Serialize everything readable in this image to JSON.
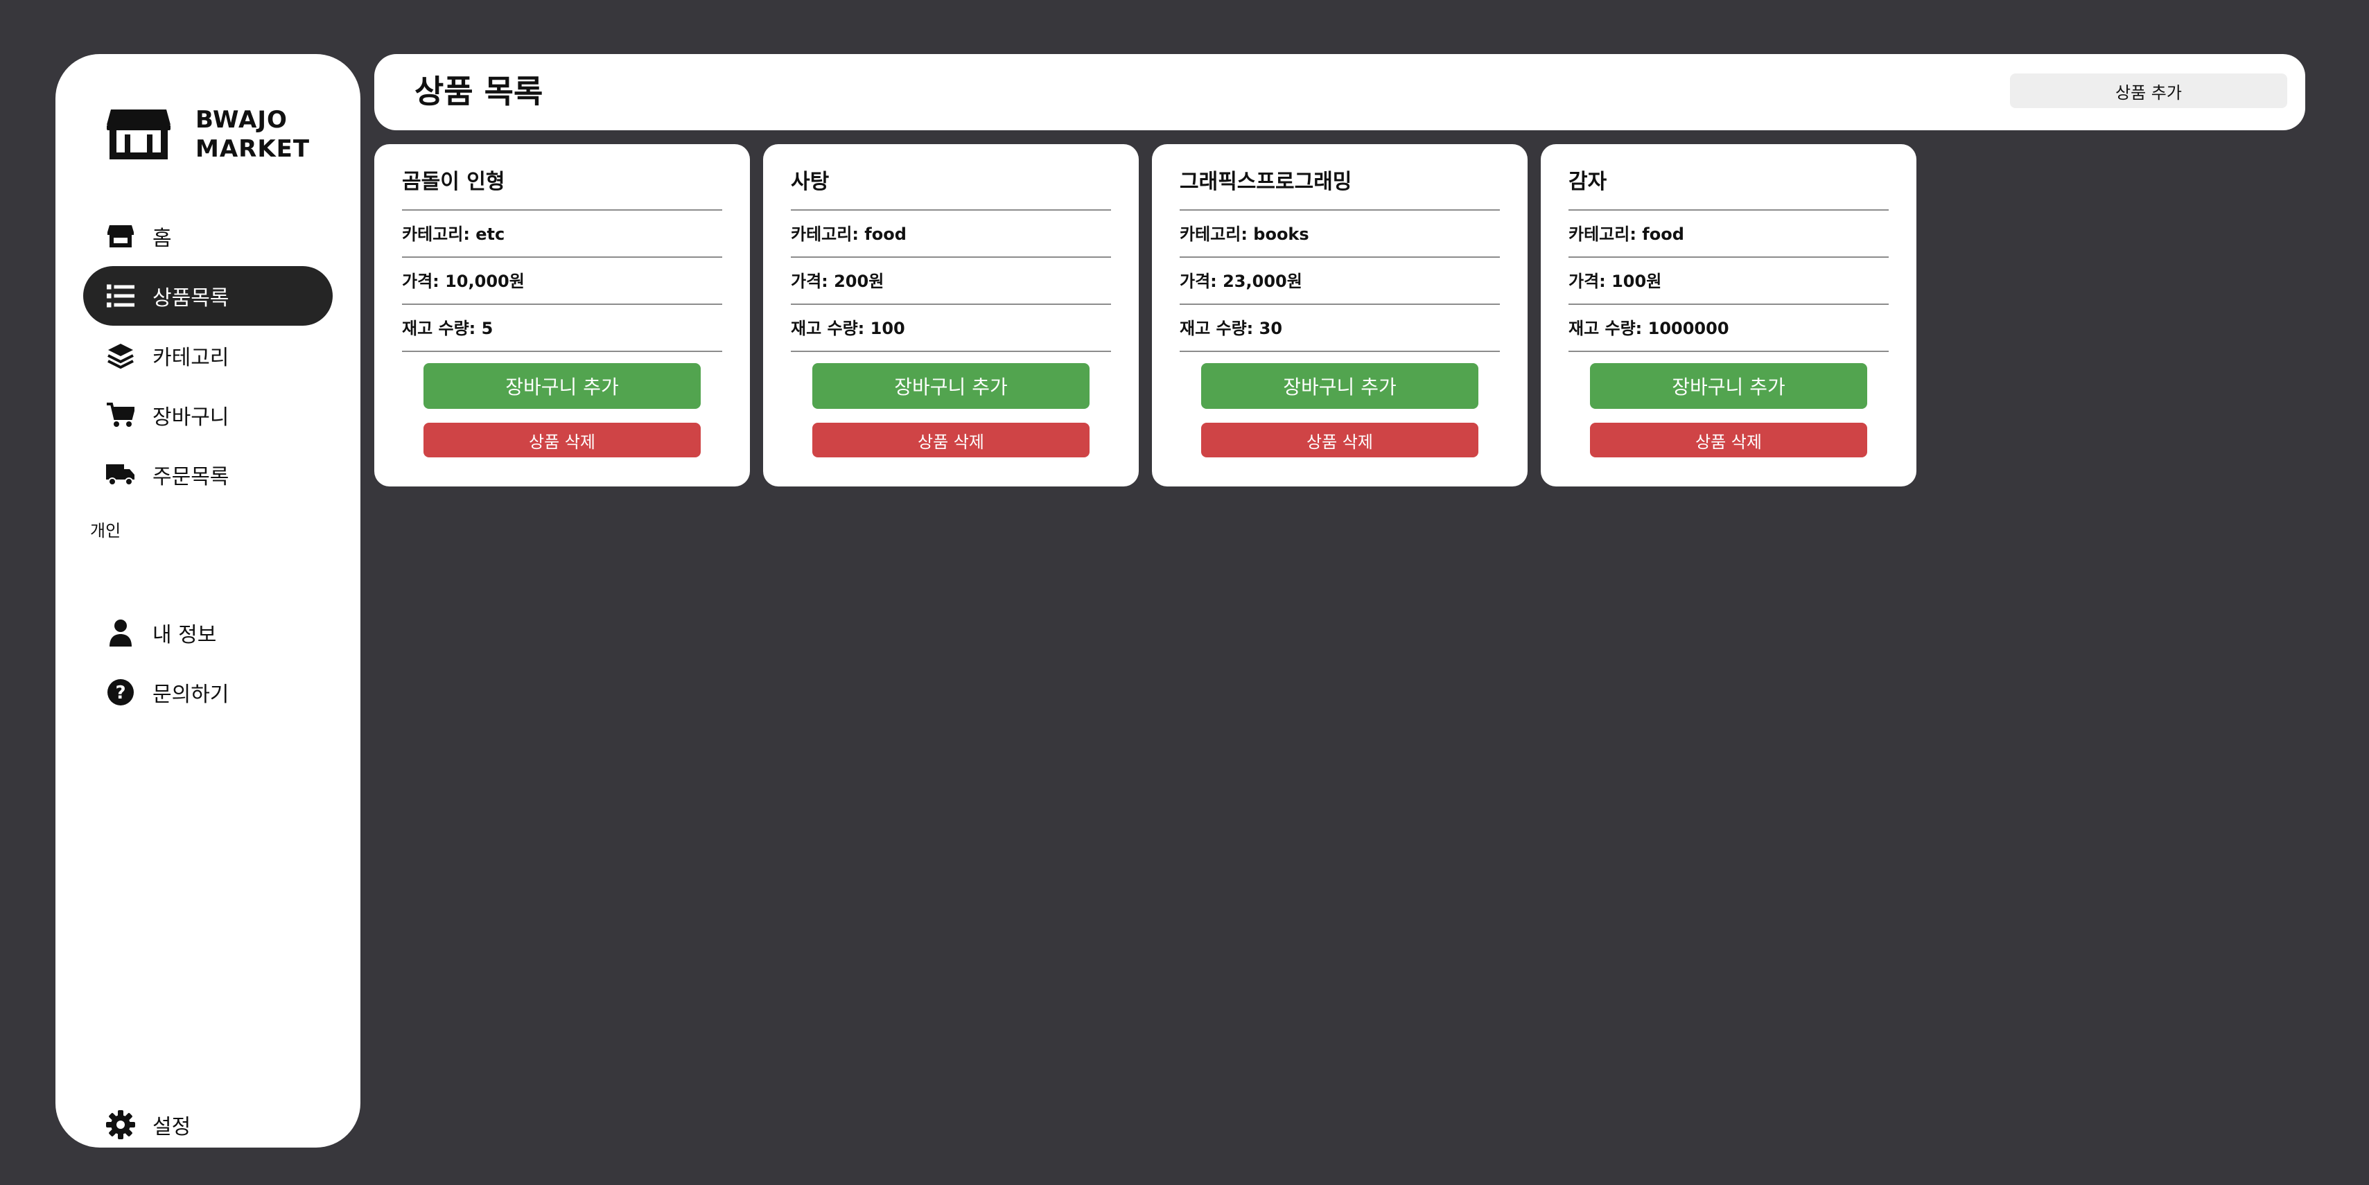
{
  "sidebar": {
    "brand_line1": "BWAJO",
    "brand_line2": "MARKET",
    "section_personal": "개인",
    "items": [
      {
        "label": "홈",
        "icon": "store-icon"
      },
      {
        "label": "상품목록",
        "icon": "list-icon",
        "active": true
      },
      {
        "label": "카테고리",
        "icon": "layers-icon"
      },
      {
        "label": "장바구니",
        "icon": "cart-icon"
      },
      {
        "label": "주문목록",
        "icon": "truck-icon"
      }
    ],
    "personal_items": [
      {
        "label": "내 정보",
        "icon": "user-icon"
      },
      {
        "label": "문의하기",
        "icon": "question-icon"
      }
    ],
    "settings": {
      "label": "설정",
      "icon": "gear-icon"
    }
  },
  "header": {
    "title": "상품 목록",
    "add_button": "상품 추가"
  },
  "products": [
    {
      "name": "곰돌이 인형",
      "category": "카테고리: etc",
      "price": "가격: 10,000원",
      "stock": "재고 수량: 5",
      "cart_label": "장바구니 추가",
      "delete_label": "상품 삭제"
    },
    {
      "name": "사탕",
      "category": "카테고리: food",
      "price": "가격: 200원",
      "stock": "재고 수량: 100",
      "cart_label": "장바구니 추가",
      "delete_label": "상품 삭제"
    },
    {
      "name": "그래픽스프로그래밍",
      "category": "카테고리: books",
      "price": "가격: 23,000원",
      "stock": "재고 수량: 30",
      "cart_label": "장바구니 추가",
      "delete_label": "상품 삭제"
    },
    {
      "name": "감자",
      "category": "카테고리: food",
      "price": "가격: 100원",
      "stock": "재고 수량: 1000000",
      "cart_label": "장바구니 추가",
      "delete_label": "상품 삭제"
    }
  ],
  "colors": {
    "background": "#38373c",
    "cart_button": "#52a44f",
    "delete_button": "#cf4446",
    "active_nav": "#252525"
  }
}
